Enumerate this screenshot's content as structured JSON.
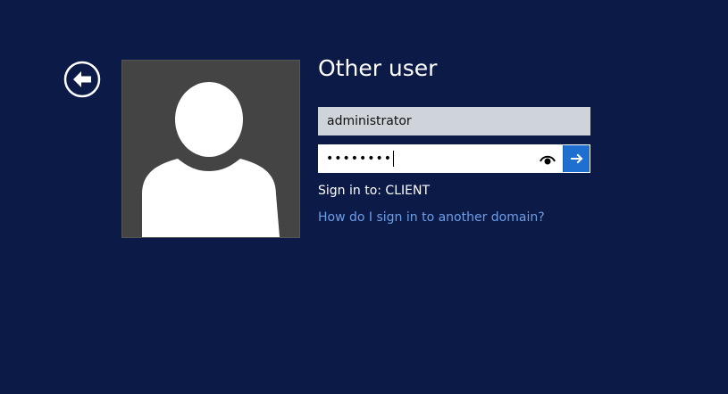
{
  "colors": {
    "background": "#0b1a47",
    "avatar_bg": "#444444",
    "username_bg": "#cfd3da",
    "submit_bg": "#1e6fd0",
    "link": "#6f9ee8"
  },
  "header": {
    "title": "Other user"
  },
  "icons": {
    "back": "back-arrow-circle-icon",
    "avatar": "user-silhouette-icon",
    "reveal": "eye-icon",
    "submit": "arrow-right-icon"
  },
  "form": {
    "username_value": "administrator",
    "password_masked": "••••••••",
    "sign_in_to": "Sign in to: CLIENT",
    "help_link": "How do I sign in to another domain?"
  }
}
